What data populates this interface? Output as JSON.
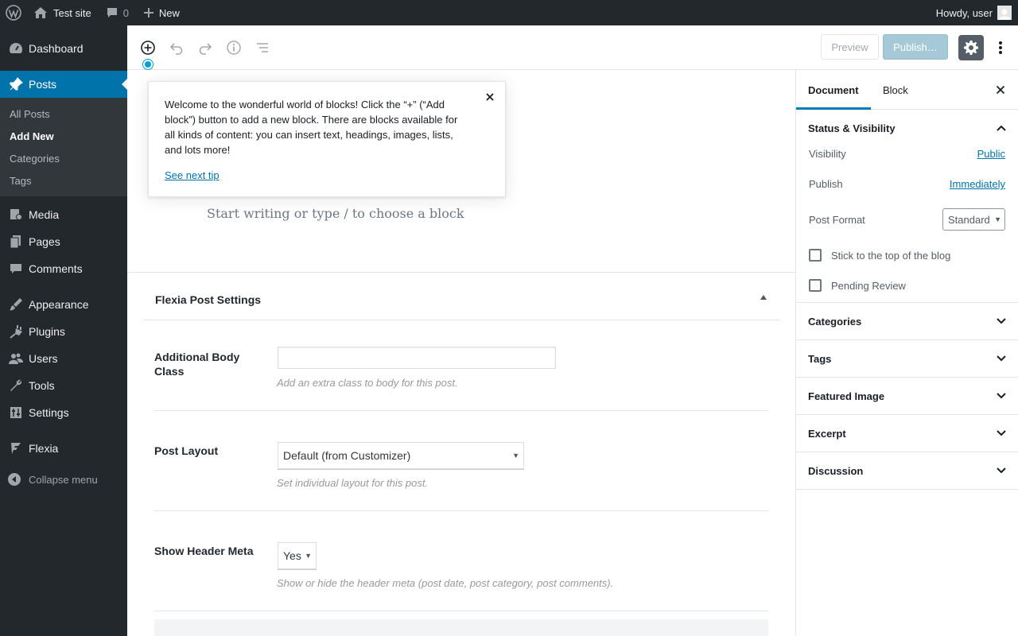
{
  "admin_bar": {
    "site_name": "Test site",
    "comment_count": "0",
    "new_label": "New",
    "howdy": "Howdy, user"
  },
  "sidebar": {
    "items": [
      {
        "label": "Dashboard",
        "icon": "dashboard-icon"
      },
      {
        "label": "Posts",
        "icon": "pushpin-icon",
        "current": true
      },
      {
        "label": "Media",
        "icon": "media-icon"
      },
      {
        "label": "Pages",
        "icon": "pages-icon"
      },
      {
        "label": "Comments",
        "icon": "comment-icon"
      },
      {
        "label": "Appearance",
        "icon": "paintbrush-icon"
      },
      {
        "label": "Plugins",
        "icon": "plug-icon"
      },
      {
        "label": "Users",
        "icon": "users-icon"
      },
      {
        "label": "Tools",
        "icon": "wrench-icon"
      },
      {
        "label": "Settings",
        "icon": "sliders-icon"
      },
      {
        "label": "Flexia",
        "icon": "flexia-icon"
      }
    ],
    "posts_submenu": [
      "All Posts",
      "Add New",
      "Categories",
      "Tags"
    ],
    "collapse_label": "Collapse menu"
  },
  "header": {
    "preview_label": "Preview",
    "publish_label": "Publish…"
  },
  "tip": {
    "text": "Welcome to the wonderful world of blocks! Click the “+” (“Add block”) button to add a new block. There are blocks available for all kinds of content: you can insert text, headings, images, lists, and lots more!",
    "link": "See next tip"
  },
  "editor": {
    "placeholder": "Start writing or type / to choose a block"
  },
  "metabox": {
    "title": "Flexia Post Settings",
    "fields": [
      {
        "label": "Additional Body Class",
        "value": "",
        "description": "Add an extra class to body for this post."
      },
      {
        "label": "Post Layout",
        "value": "Default (from Customizer)",
        "description": "Set individual layout for this post."
      },
      {
        "label": "Show Header Meta",
        "value": "Yes",
        "description": "Show or hide the header meta (post date, post category, post comments)."
      }
    ]
  },
  "settings_panel": {
    "tabs": [
      "Document",
      "Block"
    ],
    "status": {
      "title": "Status & Visibility",
      "visibility_label": "Visibility",
      "visibility_value": "Public",
      "publish_label": "Publish",
      "publish_value": "Immediately",
      "format_label": "Post Format",
      "format_value": "Standard",
      "stick_label": "Stick to the top of the blog",
      "pending_label": "Pending Review"
    },
    "sections": [
      "Categories",
      "Tags",
      "Featured Image",
      "Excerpt",
      "Discussion"
    ]
  },
  "colors": {
    "admin_bg": "#23282d",
    "accent": "#0073aa",
    "publish_disabled": "#a6c9d8"
  }
}
